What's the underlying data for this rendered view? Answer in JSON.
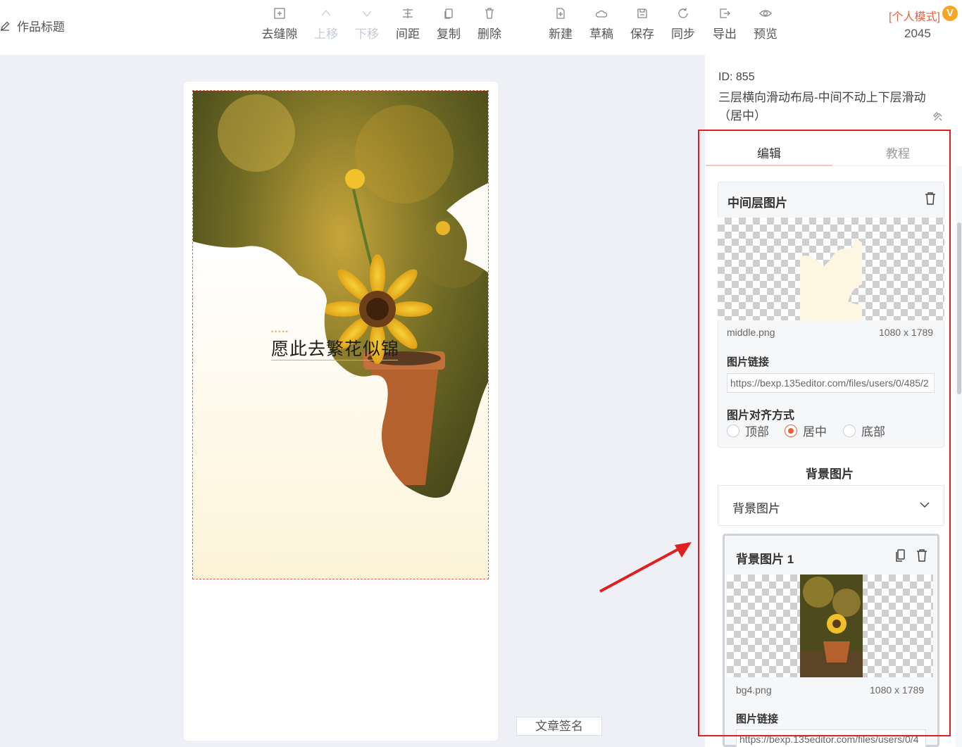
{
  "header": {
    "doc_title": "作品标题",
    "toolbar_left": [
      {
        "label": "去缝隙",
        "icon": "gap-remove-icon"
      },
      {
        "label": "上移",
        "icon": "chevron-up-icon"
      },
      {
        "label": "下移",
        "icon": "chevron-down-icon"
      },
      {
        "label": "间距",
        "icon": "spacing-icon"
      },
      {
        "label": "复制",
        "icon": "copy-icon"
      },
      {
        "label": "删除",
        "icon": "trash-icon"
      }
    ],
    "toolbar_right": [
      {
        "label": "新建",
        "icon": "new-file-icon"
      },
      {
        "label": "草稿",
        "icon": "cloud-icon"
      },
      {
        "label": "保存",
        "icon": "save-icon"
      },
      {
        "label": "同步",
        "icon": "sync-icon"
      },
      {
        "label": "导出",
        "icon": "export-icon"
      },
      {
        "label": "预览",
        "icon": "eye-icon"
      }
    ],
    "mode_label": "[个人模式]",
    "vip_badge": "V",
    "count": "2045"
  },
  "canvas": {
    "headline": "愿此去繁花似锦",
    "headline_dots": "•••••",
    "signature_button": "文章签名"
  },
  "panel": {
    "template_id": "ID: 855",
    "template_name": "三层横向滑动布局-中间不动上下层滑动（居中）",
    "tabs": [
      {
        "label": "编辑",
        "active": true
      },
      {
        "label": "教程",
        "active": false
      }
    ],
    "middle_layer": {
      "title": "中间层图片",
      "filename": "middle.png",
      "dimensions": "1080 x 1789",
      "link_label": "图片链接",
      "link_value": "https://bexp.135editor.com/files/users/0/485/2",
      "align_label": "图片对齐方式",
      "align_options": [
        {
          "label": "顶部",
          "checked": false
        },
        {
          "label": "居中",
          "checked": true
        },
        {
          "label": "底部",
          "checked": false
        }
      ]
    },
    "background": {
      "section_title": "背景图片",
      "select_label": "背景图片",
      "item_title": "背景图片 1",
      "filename": "bg4.png",
      "dimensions": "1080 x 1789",
      "link_label": "图片链接",
      "link_value": "https://bexp.135editor.com/files/users/0/4"
    }
  },
  "colors": {
    "accent": "#e8603c",
    "annotation_red": "#e02020",
    "selection_dash": "#e85c4a"
  }
}
